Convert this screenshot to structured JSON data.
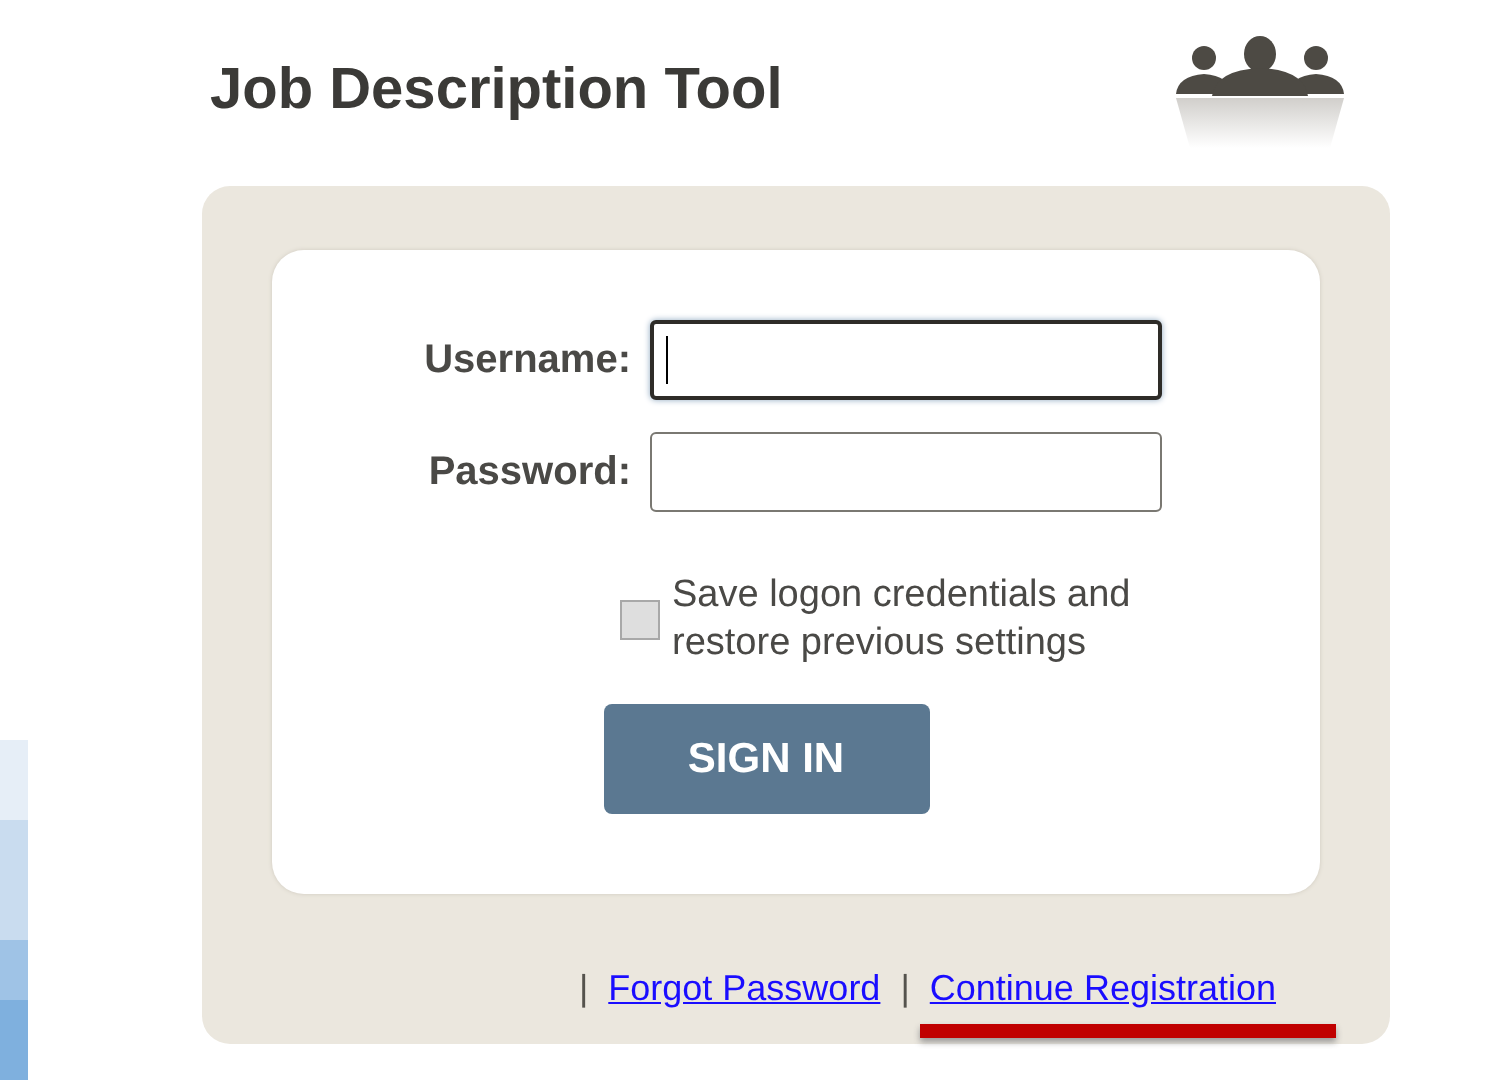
{
  "header": {
    "title": "Job Description Tool"
  },
  "form": {
    "fields": [
      {
        "label": "Username:",
        "focused": true
      },
      {
        "label": "Password:",
        "focused": false
      }
    ],
    "remember": {
      "label": "Save logon credentials and restore previous settings",
      "checked": false
    },
    "submit": "SIGN IN"
  },
  "links": [
    {
      "separator": "|",
      "label": "Forgot Password",
      "highlighted": false
    },
    {
      "separator": "|",
      "label": "Continue Registration",
      "highlighted": true
    }
  ]
}
